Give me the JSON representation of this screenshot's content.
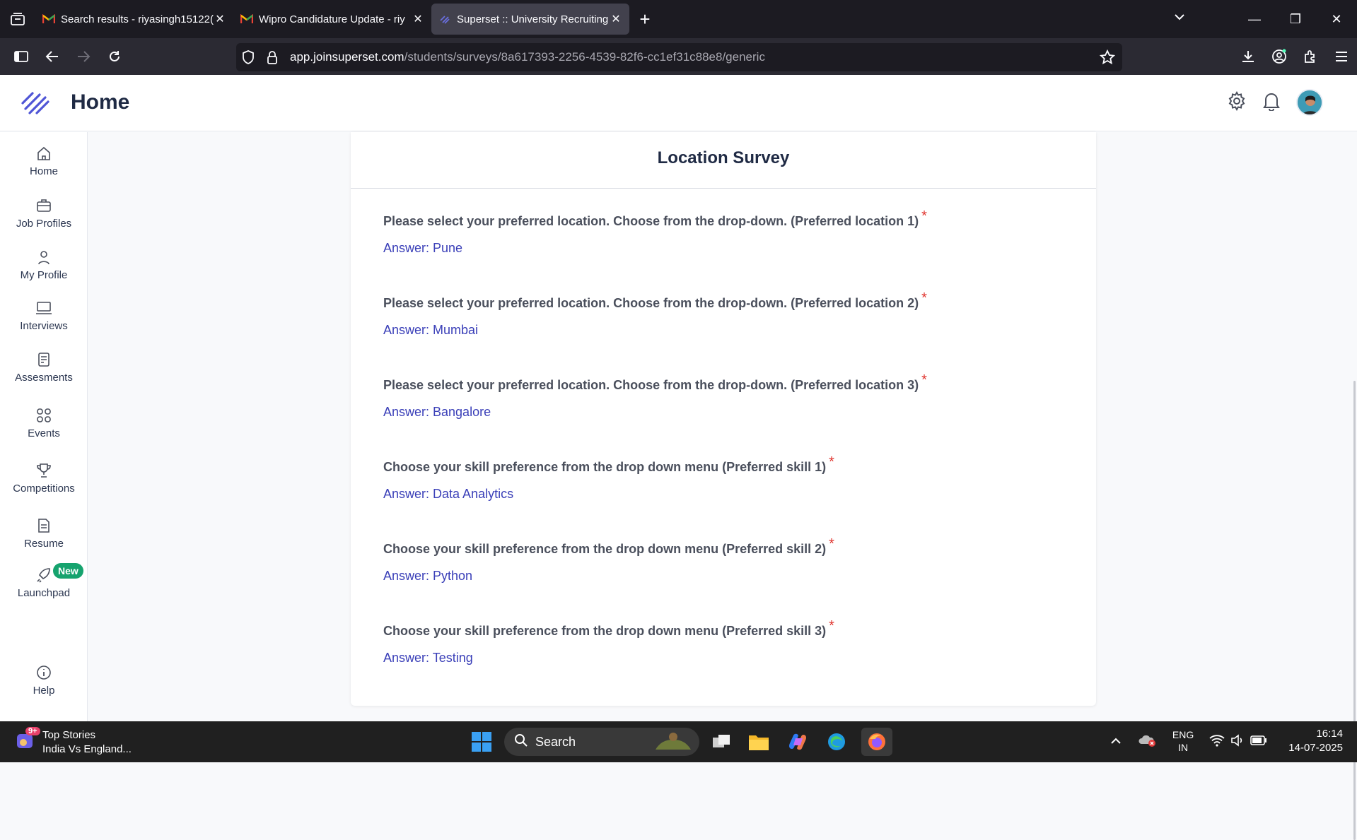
{
  "browser": {
    "tabs": [
      {
        "title": "Search results - riyasingh15122(",
        "active": false
      },
      {
        "title": "Wipro Candidature Update - riy",
        "active": false
      },
      {
        "title": "Superset :: University Recruiting",
        "active": true
      }
    ],
    "url_domain": "app.joinsuperset.com",
    "url_path": "/students/surveys/8a617393-2256-4539-82f6-cc1ef31c88e8/generic"
  },
  "header": {
    "title": "Home"
  },
  "sidebar": {
    "items": [
      {
        "label": "Home",
        "icon": "home-icon"
      },
      {
        "label": "Job Profiles",
        "icon": "briefcase-icon"
      },
      {
        "label": "My Profile",
        "icon": "user-icon"
      },
      {
        "label": "Interviews",
        "icon": "laptop-icon"
      },
      {
        "label": "Assesments",
        "icon": "clipboard-icon"
      },
      {
        "label": "Events",
        "icon": "grid-icon"
      },
      {
        "label": "Competitions",
        "icon": "trophy-icon"
      },
      {
        "label": "Resume",
        "icon": "document-icon"
      },
      {
        "label": "Launchpad",
        "icon": "rocket-icon",
        "badge": "New"
      }
    ],
    "help_label": "Help"
  },
  "survey": {
    "title": "Location Survey",
    "required_mark": "*",
    "questions": [
      {
        "text": "Please select your preferred location. Choose from the drop-down. (Preferred location 1)",
        "answer": "Answer: Pune"
      },
      {
        "text": "Please select your preferred location. Choose from the drop-down. (Preferred location 2)",
        "answer": "Answer: Mumbai"
      },
      {
        "text": "Please select your preferred location. Choose from the drop-down. (Preferred location 3)",
        "answer": "Answer: Bangalore"
      },
      {
        "text": "Choose your skill preference from the drop down menu (Preferred skill 1)",
        "answer": "Answer: Data Analytics"
      },
      {
        "text": "Choose your skill preference from the drop down menu (Preferred skill 2)",
        "answer": "Answer: Python"
      },
      {
        "text": "Choose your skill preference from the drop down menu (Preferred skill 3)",
        "answer": "Answer: Testing"
      }
    ]
  },
  "taskbar": {
    "news_badge": "9+",
    "news_title": "Top Stories",
    "news_subtitle": "India Vs England...",
    "search_label": "Search",
    "lang_top": "ENG",
    "lang_bottom": "IN",
    "time": "16:14",
    "date": "14-07-2025"
  },
  "colors": {
    "answer": "#3a3fb8",
    "required": "#e0342e",
    "badge_new": "#16a36e",
    "accent": "#4f55d6"
  }
}
